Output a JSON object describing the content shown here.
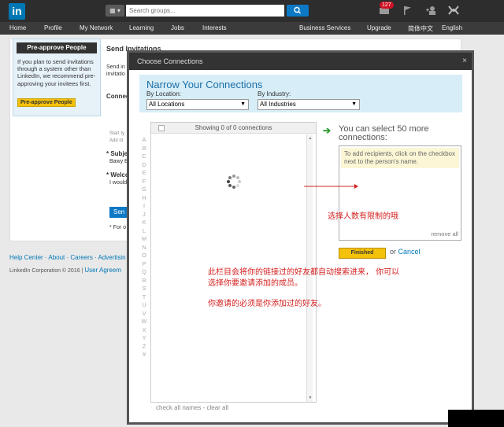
{
  "topbar": {
    "logo": "in",
    "search_type": "▦ ▾",
    "search_placeholder": "Search groups...",
    "notification_count": "127"
  },
  "nav": {
    "left": [
      "Home",
      "Profile",
      "My Network",
      "Learning",
      "Jobs",
      "Interests"
    ],
    "right": [
      "Business Services",
      "Upgrade",
      "简体中文",
      "English"
    ]
  },
  "background_page": {
    "preapprove_title": "Pre-approve People",
    "preapprove_text": "If you plan to send invitations through a system other than LinkedIn, we recommend pre-approving your invitees first.",
    "preapprove_button": "Pre-approve People",
    "heading": "Send Invitations",
    "frag1": "Send in",
    "frag2": "invitatio",
    "frag3": "Connec",
    "frag4": "Start ty",
    "frag5": "Add ot",
    "frag6": "* Subjec",
    "frag7": "Bawy B",
    "frag8": "* Welco",
    "frag9": "I would",
    "frag10": "Sen",
    "frag11": "* For o"
  },
  "footer": {
    "links": [
      "Help Center",
      "About",
      "Careers",
      "Advertisin"
    ],
    "copyright": "LinkedIn Corporation © 2016",
    "user_agreement": "User Agreem"
  },
  "modal": {
    "title": "Choose Connections",
    "close": "×",
    "narrow_title": "Narrow Your Connections",
    "location_label": "By Location:",
    "location_value": "All Locations",
    "industry_label": "By Industry:",
    "industry_value": "All Industries",
    "showing": "Showing 0 of 0 connections",
    "alphabet": [
      "A",
      "B",
      "C",
      "D",
      "E",
      "F",
      "G",
      "H",
      "I",
      "J",
      "K",
      "L",
      "M",
      "N",
      "O",
      "P",
      "Q",
      "R",
      "S",
      "T",
      "U",
      "V",
      "W",
      "X",
      "Y",
      "Z",
      "#"
    ],
    "check_all": "check all names - clear all",
    "can_select": "You can select 50 more connections:",
    "recip_hint": "To add recipients, click on the checkbox next to the person's name.",
    "remove_all": "remove all",
    "finished": "Finished",
    "or": "or",
    "cancel": "Cancel"
  },
  "annotations": {
    "limit_note": "选择人数有限制的哦",
    "auto_search": "此栏目会将你的链接过的好友都自动搜索进来， 你可以",
    "auto_search2": "选择你要邀请添加的成员。",
    "must_add": "你邀请的必须是你添加过的好友。"
  }
}
